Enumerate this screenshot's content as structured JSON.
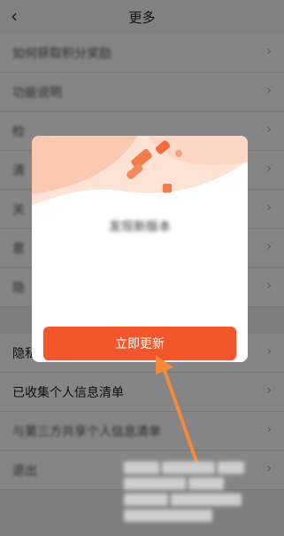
{
  "header": {
    "back_icon": "chevron-left-icon",
    "title": "更多"
  },
  "list": {
    "rows": [
      {
        "label": "如何获取积分奖励",
        "blurred": true
      },
      {
        "label": "功能说明",
        "blurred": true
      },
      {
        "label": "检",
        "blurred": true
      },
      {
        "label": "清",
        "blurred": true
      },
      {
        "label": "关",
        "blurred": true
      },
      {
        "label": "意",
        "blurred": true
      },
      {
        "label": "隐",
        "blurred": true
      },
      {
        "label": "隐私",
        "blurred": false
      },
      {
        "label": "已收集个人信息清单",
        "blurred": false
      },
      {
        "label": "与第三方共享个人信息清单",
        "blurred": true
      },
      {
        "label": "退出",
        "blurred": true
      }
    ]
  },
  "dialog": {
    "title": "发现新版本",
    "subtitle": "",
    "description": "",
    "update_button": "立即更新",
    "accent": "#f2562a"
  }
}
